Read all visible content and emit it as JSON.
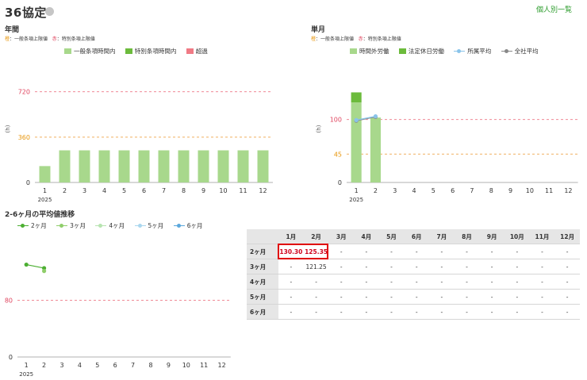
{
  "page": {
    "title": "36協定",
    "top_link": "個人別一覧"
  },
  "annual": {
    "title": "年間",
    "limit_legend": {
      "orange": "橙",
      "orange_text": "：一般条項上限値",
      "red": "赤",
      "red_text": "：特別条項上限値"
    },
    "legend": [
      {
        "label": "一般条項時間内",
        "color": "#a8d88c"
      },
      {
        "label": "特別条項時間内",
        "color": "#6cbb3c"
      },
      {
        "label": "超過",
        "color": "#f07a85"
      }
    ],
    "y_unit": "(h)"
  },
  "monthly": {
    "title": "単月",
    "limit_legend": {
      "orange": "橙",
      "orange_text": "：一般条項上限値",
      "red": "赤",
      "red_text": "：特別条項上限値"
    },
    "legend": [
      {
        "label": "時間外労働",
        "color": "#a8d88c"
      },
      {
        "label": "法定休日労働",
        "color": "#6cbb3c"
      },
      {
        "label": "所属平均",
        "color": "#8ac4ea"
      },
      {
        "label": "全社平均",
        "color": "#888888"
      }
    ],
    "y_unit": "(h)"
  },
  "average": {
    "title": "2-6ヶ月の平均値推移",
    "legend": [
      {
        "label": "2ヶ月",
        "color": "#4caf32"
      },
      {
        "label": "3ヶ月",
        "color": "#8fce6a"
      },
      {
        "label": "4ヶ月",
        "color": "#b7e4b0"
      },
      {
        "label": "5ヶ月",
        "color": "#aad7ef"
      },
      {
        "label": "6ヶ月",
        "color": "#5ba8dc"
      }
    ]
  },
  "table": {
    "headers": [
      "1月",
      "2月",
      "3月",
      "4月",
      "5月",
      "6月",
      "7月",
      "8月",
      "9月",
      "10月",
      "11月",
      "12月"
    ],
    "rows": [
      {
        "label": "2ヶ月",
        "cells": [
          "130.30",
          "125.35",
          "-",
          "-",
          "-",
          "-",
          "-",
          "-",
          "-",
          "-",
          "-",
          "-"
        ]
      },
      {
        "label": "3ヶ月",
        "cells": [
          "-",
          "121.25",
          "-",
          "-",
          "-",
          "-",
          "-",
          "-",
          "-",
          "-",
          "-",
          "-"
        ]
      },
      {
        "label": "4ヶ月",
        "cells": [
          "-",
          "-",
          "-",
          "-",
          "-",
          "-",
          "-",
          "-",
          "-",
          "-",
          "-",
          "-"
        ]
      },
      {
        "label": "5ヶ月",
        "cells": [
          "-",
          "-",
          "-",
          "-",
          "-",
          "-",
          "-",
          "-",
          "-",
          "-",
          "-",
          "-"
        ]
      },
      {
        "label": "6ヶ月",
        "cells": [
          "-",
          "-",
          "-",
          "-",
          "-",
          "-",
          "-",
          "-",
          "-",
          "-",
          "-",
          "-"
        ]
      }
    ]
  },
  "chart_data": [
    {
      "name": "annual",
      "type": "bar",
      "categories": [
        "1",
        "2",
        "3",
        "4",
        "5",
        "6",
        "7",
        "8",
        "9",
        "10",
        "11",
        "12"
      ],
      "year_label": "2025",
      "series": [
        {
          "name": "一般条項時間内",
          "values": [
            130,
            255,
            255,
            255,
            255,
            255,
            255,
            255,
            255,
            255,
            255,
            255
          ]
        }
      ],
      "bar_color": "#a8d88c",
      "ylim": [
        0,
        850
      ],
      "ticks": [
        {
          "value": 0,
          "label": "0",
          "color": "#333333",
          "line": "none"
        },
        {
          "value": 360,
          "label": "360",
          "color": "#e8960c",
          "line": "#f0b060"
        },
        {
          "value": 720,
          "label": "720",
          "color": "#e0455f",
          "line": "#f08a96"
        }
      ],
      "ylabel": "(h)"
    },
    {
      "name": "monthly",
      "type": "bar",
      "categories": [
        "1",
        "2",
        "3",
        "4",
        "5",
        "6",
        "7",
        "8",
        "9",
        "10",
        "11",
        "12"
      ],
      "year_label": "2025",
      "series": [
        {
          "name": "時間外労働",
          "values": [
            127,
            103,
            0,
            0,
            0,
            0,
            0,
            0,
            0,
            0,
            0,
            0
          ],
          "color": "#a8d88c"
        },
        {
          "name": "法定休日労働",
          "values": [
            16,
            0,
            0,
            0,
            0,
            0,
            0,
            0,
            0,
            0,
            0,
            0
          ],
          "color": "#6cbb3c"
        }
      ],
      "lines": [
        {
          "name": "全社平均",
          "values": [
            98,
            104
          ],
          "color": "#888888"
        },
        {
          "name": "所属平均",
          "values": [
            99,
            105
          ],
          "color": "#8ac4ea"
        }
      ],
      "ylim": [
        0,
        170
      ],
      "ticks": [
        {
          "value": 0,
          "label": "0",
          "color": "#333333",
          "line": "none"
        },
        {
          "value": 45,
          "label": "45",
          "color": "#e8960c",
          "line": "#f0b060"
        },
        {
          "value": 100,
          "label": "100",
          "color": "#e0455f",
          "line": "#f08a96"
        }
      ],
      "ylabel": "(h)"
    },
    {
      "name": "average",
      "type": "line",
      "categories": [
        "1",
        "2",
        "3",
        "4",
        "5",
        "6",
        "7",
        "8",
        "9",
        "10",
        "11",
        "12"
      ],
      "year_label": "2025",
      "series": [
        {
          "name": "2ヶ月",
          "values": [
            130.3,
            125.35
          ],
          "color": "#4caf32"
        },
        {
          "name": "3ヶ月",
          "values": [
            null,
            121.25
          ],
          "color": "#8fce6a"
        }
      ],
      "ylim": [
        0,
        160
      ],
      "ticks": [
        {
          "value": 0,
          "label": "0",
          "color": "#333333",
          "line": "none"
        },
        {
          "value": 80,
          "label": "80",
          "color": "#e0455f",
          "line": "#f08a96"
        }
      ]
    }
  ]
}
